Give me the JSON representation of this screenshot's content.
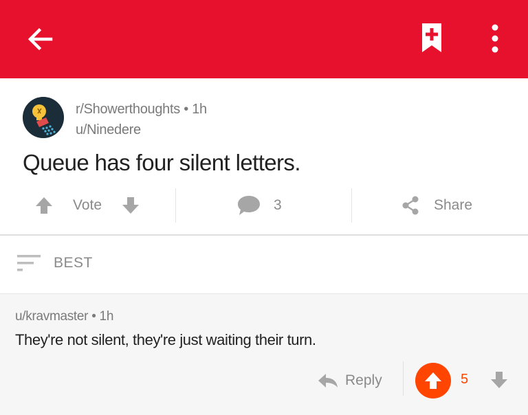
{
  "topbar": {
    "color": "#e8112d",
    "back_icon": "arrow-left-icon",
    "bookmark_icon": "bookmark-plus-icon",
    "more_icon": "more-vertical-icon"
  },
  "post": {
    "subreddit": "r/Showerthoughts",
    "age": "1h",
    "author": "u/Ninedere",
    "title": "Queue has four silent letters.",
    "vote_label": "Vote",
    "comment_count": "3",
    "share_label": "Share"
  },
  "sort": {
    "label": "BEST"
  },
  "comment": {
    "author": "u/kravmaster",
    "age": "1h",
    "body": "They're not silent, they're just waiting their turn.",
    "reply_label": "Reply",
    "score": "5",
    "accent": "#ff4500"
  }
}
